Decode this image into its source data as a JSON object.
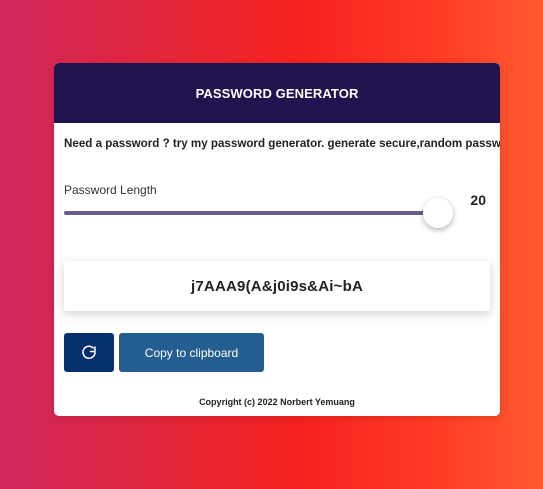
{
  "header": {
    "title": "PASSWORD GENERATOR"
  },
  "intro": {
    "text": "Need a password ? try my password generator. generate secure,random passwords."
  },
  "length": {
    "label": "Password Length",
    "value": "20",
    "slider_fraction": 0.97
  },
  "password": {
    "value": "j7AAA9(A&j0i9s&Ai~bA"
  },
  "buttons": {
    "refresh_icon": "refresh-icon",
    "copy_label": "Copy to clipboard"
  },
  "footer": {
    "text": "Copyright (c) 2022 Norbert Yemuang"
  },
  "colors": {
    "header_bg": "#21134e",
    "slider_fill": "#6b5b88",
    "refresh_button": "#07306f",
    "copy_button": "#245d8f"
  }
}
